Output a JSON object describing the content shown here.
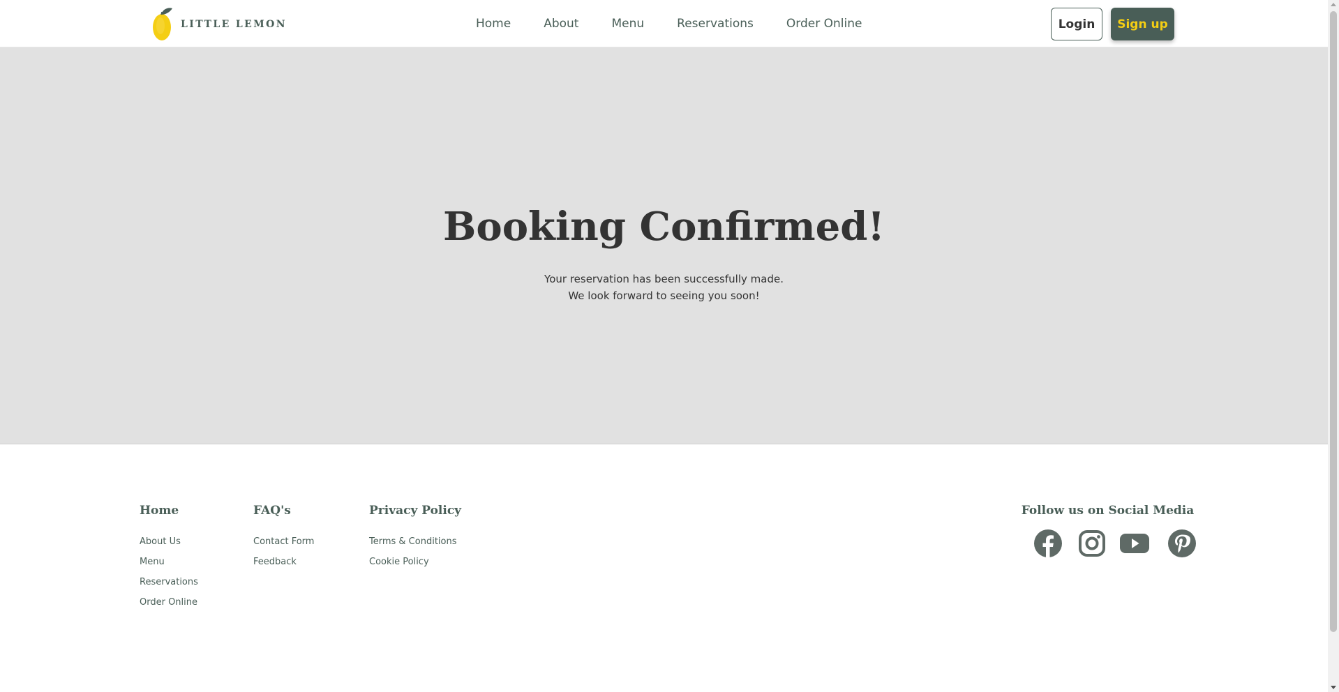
{
  "header": {
    "brand": "LITTLE LEMON",
    "nav": [
      "Home",
      "About",
      "Menu",
      "Reservations",
      "Order Online"
    ],
    "login_label": "Login",
    "signup_label": "Sign up"
  },
  "hero": {
    "title": "Booking Confirmed!",
    "line1": "Your reservation has been successfully made.",
    "line2": "We look forward to seeing you soon!"
  },
  "footer": {
    "columns": [
      {
        "title": "Home",
        "links": [
          "About Us",
          "Menu",
          "Reservations",
          "Order Online"
        ]
      },
      {
        "title": "FAQ's",
        "links": [
          "Contact Form",
          "Feedback"
        ]
      },
      {
        "title": "Privacy Policy",
        "links": [
          "Terms & Conditions",
          "Cookie Policy"
        ]
      }
    ],
    "social_title": "Follow us on Social Media",
    "social_icons": [
      "facebook-icon",
      "instagram-icon",
      "youtube-icon",
      "pinterest-icon"
    ]
  },
  "colors": {
    "primary_green": "#495e57",
    "accent_yellow": "#f4ce14",
    "hero_background": "#e1e1e1",
    "text_dark": "#333333"
  }
}
